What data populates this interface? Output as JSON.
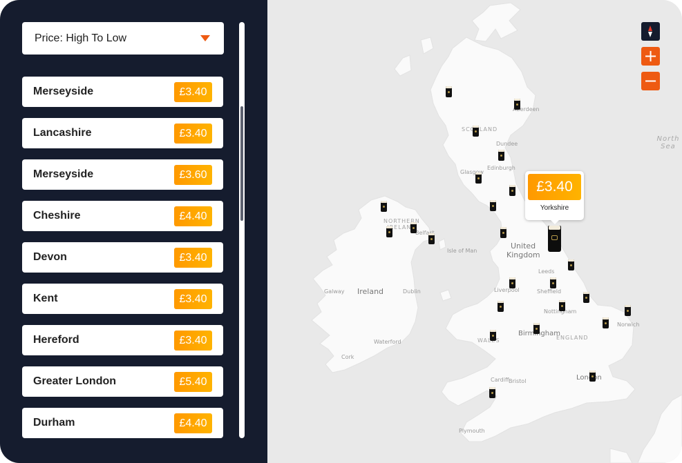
{
  "sort": {
    "label": "Price: High To Low",
    "icon": "caret-down-icon"
  },
  "locations": [
    {
      "name": "Merseyside",
      "price": "£3.40"
    },
    {
      "name": "Lancashire",
      "price": "£3.40"
    },
    {
      "name": "Merseyside",
      "price": "£3.60"
    },
    {
      "name": "Cheshire",
      "price": "£4.40"
    },
    {
      "name": "Devon",
      "price": "£3.40"
    },
    {
      "name": "Kent",
      "price": "£3.40"
    },
    {
      "name": "Hereford",
      "price": "£3.40"
    },
    {
      "name": "Greater London",
      "price": "£5.40"
    },
    {
      "name": "Durham",
      "price": "£4.40"
    }
  ],
  "popup": {
    "price": "£3.40",
    "location": "Yorkshire"
  },
  "map_labels": {
    "north_sea_1": "North",
    "north_sea_2": "Sea",
    "united_kingdom_1": "United",
    "united_kingdom_2": "Kingdom",
    "ireland": "Ireland",
    "scotland": "SCOTLAND",
    "northern_ireland_1": "NORTHERN",
    "northern_ireland_2": "IRELAND",
    "wales": "WALES",
    "england": "ENGLAND",
    "aberdeen": "Aberdeen",
    "dundee": "Dundee",
    "edinburgh": "Edinburgh",
    "glasgow": "Glasgow",
    "belfast": "Belfast",
    "isle_of_man": "Isle of Man",
    "leeds": "Leeds",
    "liverpool": "Liverpool",
    "sheffield": "Sheffield",
    "nottingham": "Nottingham",
    "norwich": "Norwich",
    "birmingham": "Birmingham",
    "cardiff": "Cardiff",
    "bristol": "Bristol",
    "london": "London",
    "plymouth": "Plymouth",
    "galway": "Galway",
    "dublin": "Dublin",
    "waterford": "Waterford",
    "cork": "Cork"
  },
  "controls": {
    "compass": "compass-icon",
    "zoom_in": "+",
    "zoom_out": "−"
  },
  "colors": {
    "sidebar_bg": "#151c2e",
    "accent_orange": "#ee5a12",
    "price_badge": "#ffa300",
    "land": "#fafafa",
    "water": "#e9e9e9"
  }
}
